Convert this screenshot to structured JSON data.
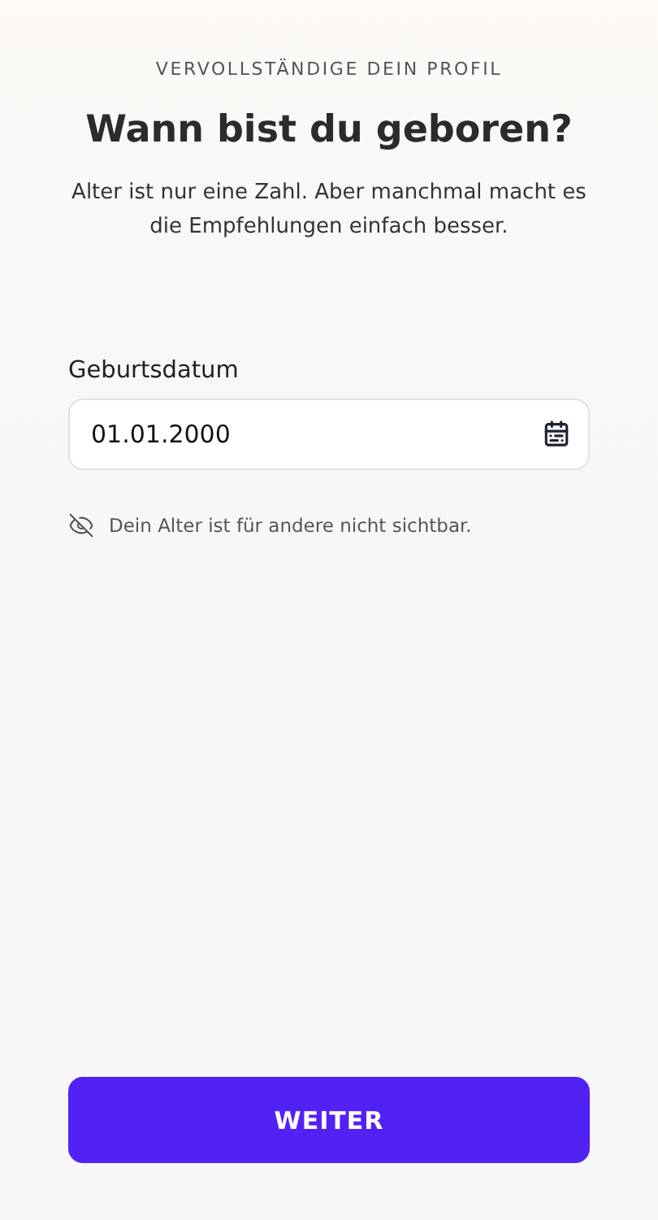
{
  "header": {
    "eyebrow": "VERVOLLSTÄNDIGE DEIN PROFIL",
    "title": "Wann bist du geboren?",
    "subtitle": "Alter ist nur eine Zahl. Aber manchmal macht es die Empfehlungen einfach besser."
  },
  "birthdate": {
    "label": "Geburtsdatum",
    "value": "01.01.2000"
  },
  "privacy_note": "Dein Alter ist für andere nicht sichtbar.",
  "primary_button": "WEITER"
}
